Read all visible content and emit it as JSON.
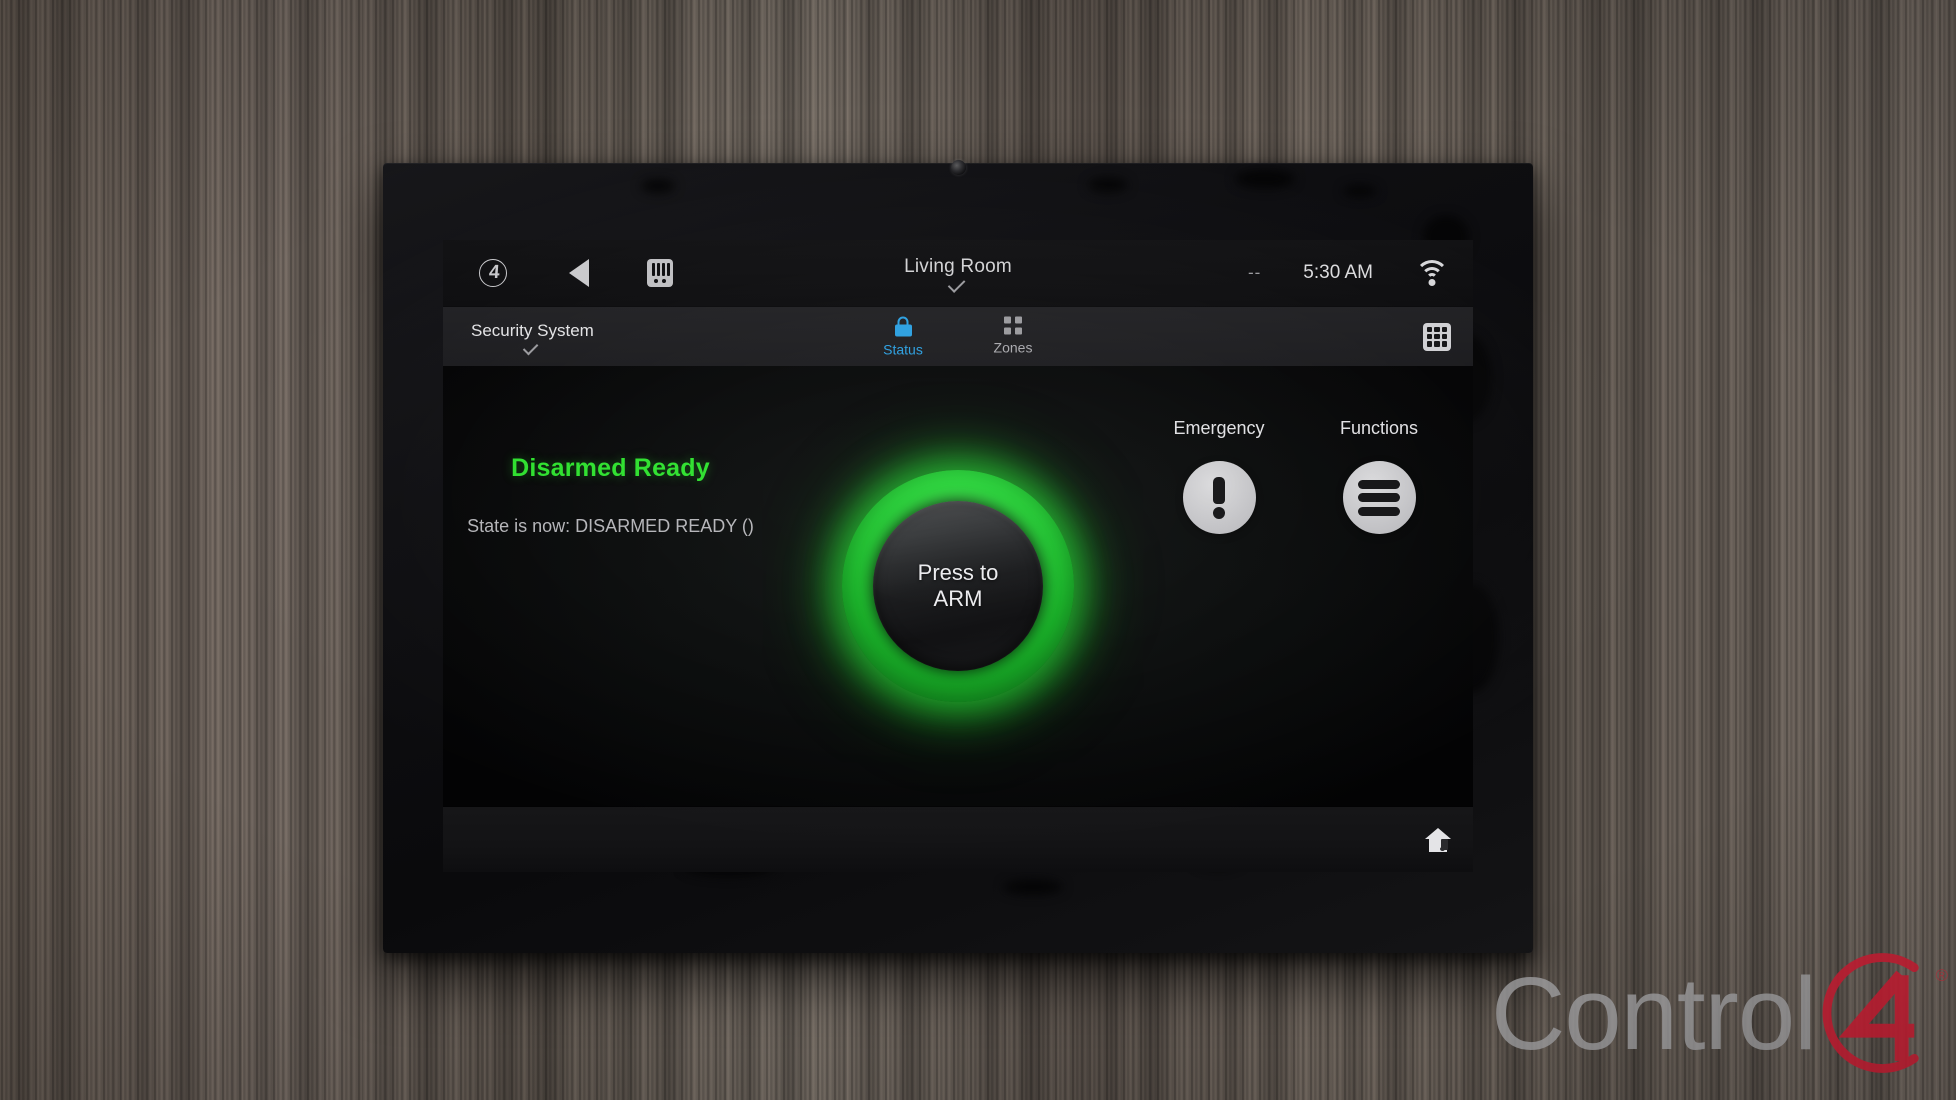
{
  "device": {
    "name": "control4-touchscreen"
  },
  "statusbar": {
    "logo_icon": "control4-logo-icon",
    "logo_char": "4",
    "back_icon": "back-arrow-icon",
    "intercom_icon": "intercom-icon",
    "room": "Living Room",
    "room_chevron_icon": "chevron-down-icon",
    "temperature": "--",
    "time": "5:30 AM",
    "wifi_icon": "wifi-icon"
  },
  "tabbar": {
    "system_name": "Security System",
    "system_chevron_icon": "chevron-down-icon",
    "tabs": [
      {
        "label": "Status",
        "icon": "lock-icon",
        "active": true
      },
      {
        "label": "Zones",
        "icon": "grid-icon",
        "active": false
      }
    ],
    "keypad_icon": "keypad-icon"
  },
  "main": {
    "status_headline": "Disarmed Ready",
    "status_detail": "State is now: DISARMED READY ()",
    "status_color": "#2ce02c",
    "arm_button": {
      "line1": "Press to",
      "line2": "ARM",
      "ring_color": "#22d730"
    },
    "actions": [
      {
        "label": "Emergency",
        "icon": "exclamation-icon"
      },
      {
        "label": "Functions",
        "icon": "hamburger-menu-icon"
      }
    ]
  },
  "bottombar": {
    "home_icon": "home-music-icon"
  },
  "watermark": {
    "text": "Control",
    "mark_icon": "control4-brand-mark",
    "registered": "®",
    "text_color": "#a8a8ab",
    "mark_color": "#cf1f35"
  }
}
